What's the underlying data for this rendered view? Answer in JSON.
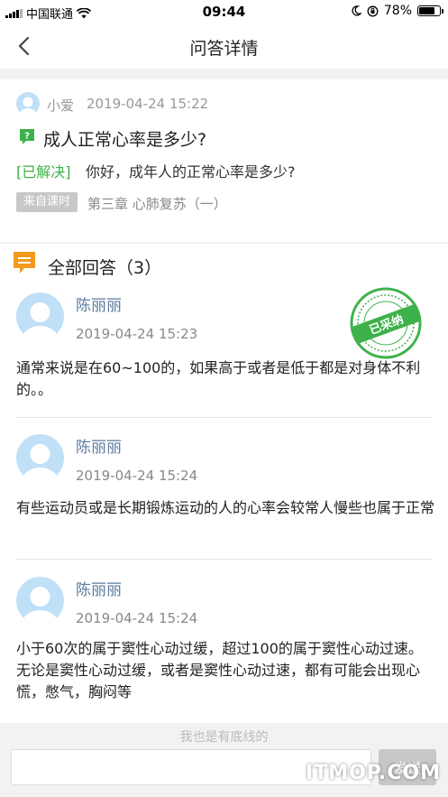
{
  "status_bar": {
    "carrier": "中国联通",
    "time": "09:44",
    "battery": "78%",
    "battery_level": 0.78,
    "icons": [
      "signal-icon",
      "wifi-icon",
      "moon-icon",
      "orientation-lock-icon",
      "battery-icon"
    ]
  },
  "nav": {
    "title": "问答详情",
    "back_icon": "chevron-left-icon"
  },
  "question": {
    "asker": "小爱",
    "time": "2019-04-24 15:22",
    "title": "成人正常心率是多少?",
    "status": "[已解决]",
    "body": "你好，成年人的正常心率是多少?",
    "source_tag": "来自课时",
    "source": "第三章 心肺复苏（一）"
  },
  "answers": {
    "heading": "全部回答（3）",
    "accepted_stamp": "已采纳",
    "items": [
      {
        "name": "陈丽丽",
        "time": "2019-04-24 15:23",
        "body": "通常来说是在60~100的，如果高于或者是低于都是对身体不利的。。",
        "accepted": true
      },
      {
        "name": "陈丽丽",
        "time": "2019-04-24 15:24",
        "body": "有些运动员或是长期锻炼运动的人的心率会较常人慢些也属于正常",
        "accepted": false
      },
      {
        "name": "陈丽丽",
        "time": "2019-04-24 15:24",
        "body": "小于60次的属于窦性心动过缓，超过100的属于窦性心动过速。无论是窦性心动过缓，或者是窦性心动过速，都有可能会出现心慌，憋气，胸闷等",
        "accepted": false
      }
    ]
  },
  "input_bar": {
    "hint": "我也是有底线的",
    "placeholder": "",
    "send_label": "发送"
  },
  "watermark": "ITMOP.COM",
  "colors": {
    "accent_green": "#3eb24a",
    "answer_icon": "#f39a1e",
    "name_blue": "#5b7aa0",
    "avatar_bg": "#bfe0f7"
  }
}
